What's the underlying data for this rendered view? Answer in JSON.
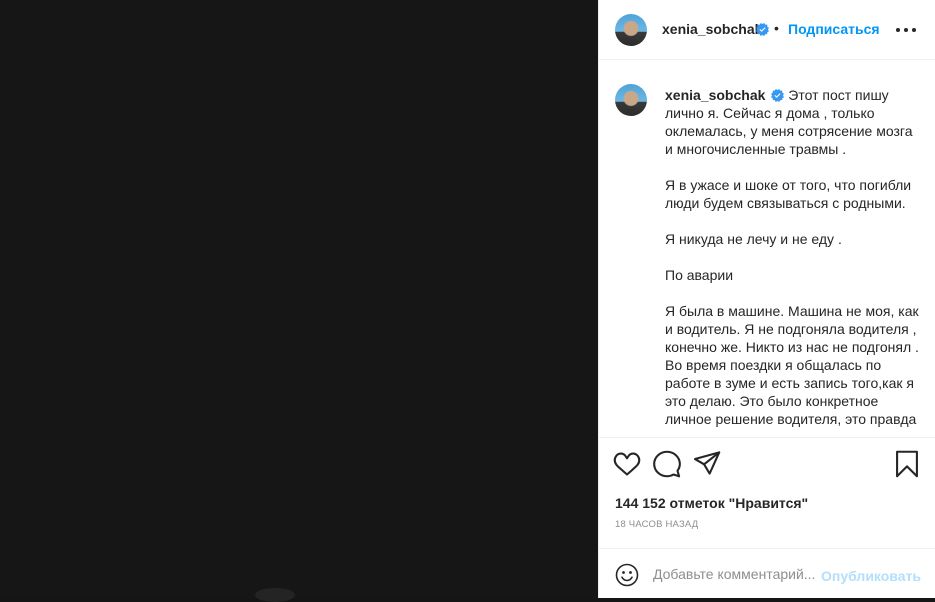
{
  "header": {
    "username": "xenia_sobchak",
    "separator": "•",
    "follow_label": "Подписаться",
    "avatar_icon": "profile-avatar",
    "verified_icon": "verified-badge-icon",
    "more_icon": "more-options-icon"
  },
  "caption": {
    "username": "xenia_sobchak",
    "paragraphs": [
      "Этот пост пишу лично я. Сейчас я дома , только оклемалась, у меня сотрясение мозга и многочисленные травмы .",
      "Я в ужасе и шоке от того, что погибли люди будем связываться с родными.",
      "Я никуда не лечу и не еду .",
      "По аварии",
      "Я была в машине. Машина не моя, как и водитель. Я не подгоняла водителя , конечно же. Никто из нас не подгонял . Во время поездки я общалась по работе в зуме и есть запись того,как я это делаю. Это было конкретное личное решение водителя, это правда"
    ]
  },
  "actions": {
    "like_icon": "heart-icon",
    "comment_icon": "comment-icon",
    "share_icon": "paper-plane-icon",
    "save_icon": "bookmark-icon"
  },
  "likes_text": "144 152 отметок \"Нравится\"",
  "timestamp": "18 часов назад",
  "comment_box": {
    "emoji_icon": "emoji-smile-icon",
    "placeholder": "Добавьте комментарий...",
    "publish_label": "Опубликовать"
  },
  "colors": {
    "accent": "#0095f6",
    "accent_disabled": "#b2dffc",
    "verified": "#3897f0",
    "media_background": "#161616",
    "secondary_text": "#8e8e8e"
  }
}
